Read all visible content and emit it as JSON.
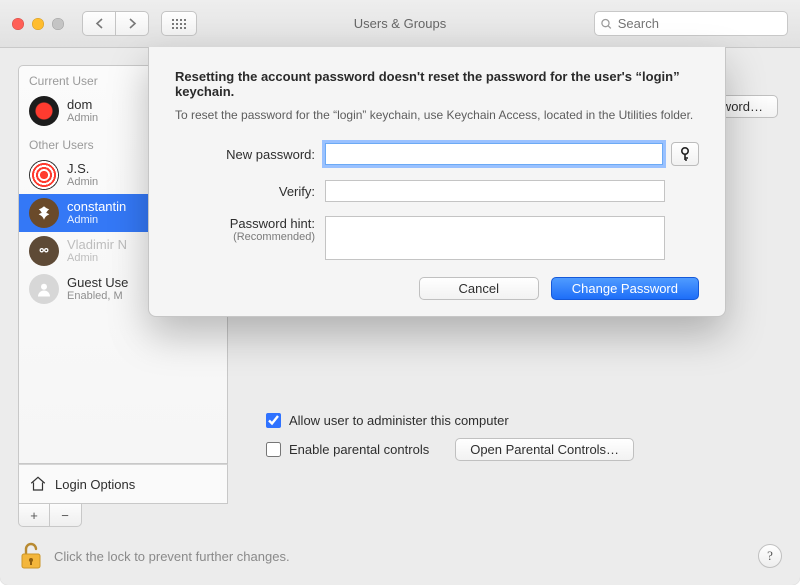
{
  "window": {
    "title": "Users & Groups"
  },
  "search": {
    "placeholder": "Search"
  },
  "sidebar": {
    "section_current": "Current User",
    "section_other": "Other Users",
    "login_options": "Login Options",
    "users": [
      {
        "name": "dom",
        "sub": "Admin"
      },
      {
        "name": "J.S.",
        "sub": "Admin"
      },
      {
        "name": "constantin",
        "sub": "Admin"
      },
      {
        "name": "Vladimir N",
        "sub": "Admin"
      },
      {
        "name": "Guest Use",
        "sub": "Enabled, M"
      }
    ]
  },
  "content": {
    "change_password_btn": "assword…",
    "allow_admin": "Allow user to administer this computer",
    "enable_parental": "Enable parental controls",
    "open_parental": "Open Parental Controls…"
  },
  "footer": {
    "lock_text": "Click the lock to prevent further changes.",
    "help": "?"
  },
  "sheet": {
    "heading": "Resetting the account password doesn't reset the password for the user's “login” keychain.",
    "explain": "To reset the password for the “login” keychain, use Keychain Access, located in the Utilities folder.",
    "labels": {
      "new_password": "New password:",
      "verify": "Verify:",
      "hint": "Password hint:",
      "hint_sub": "(Recommended)"
    },
    "buttons": {
      "cancel": "Cancel",
      "change": "Change Password"
    }
  }
}
